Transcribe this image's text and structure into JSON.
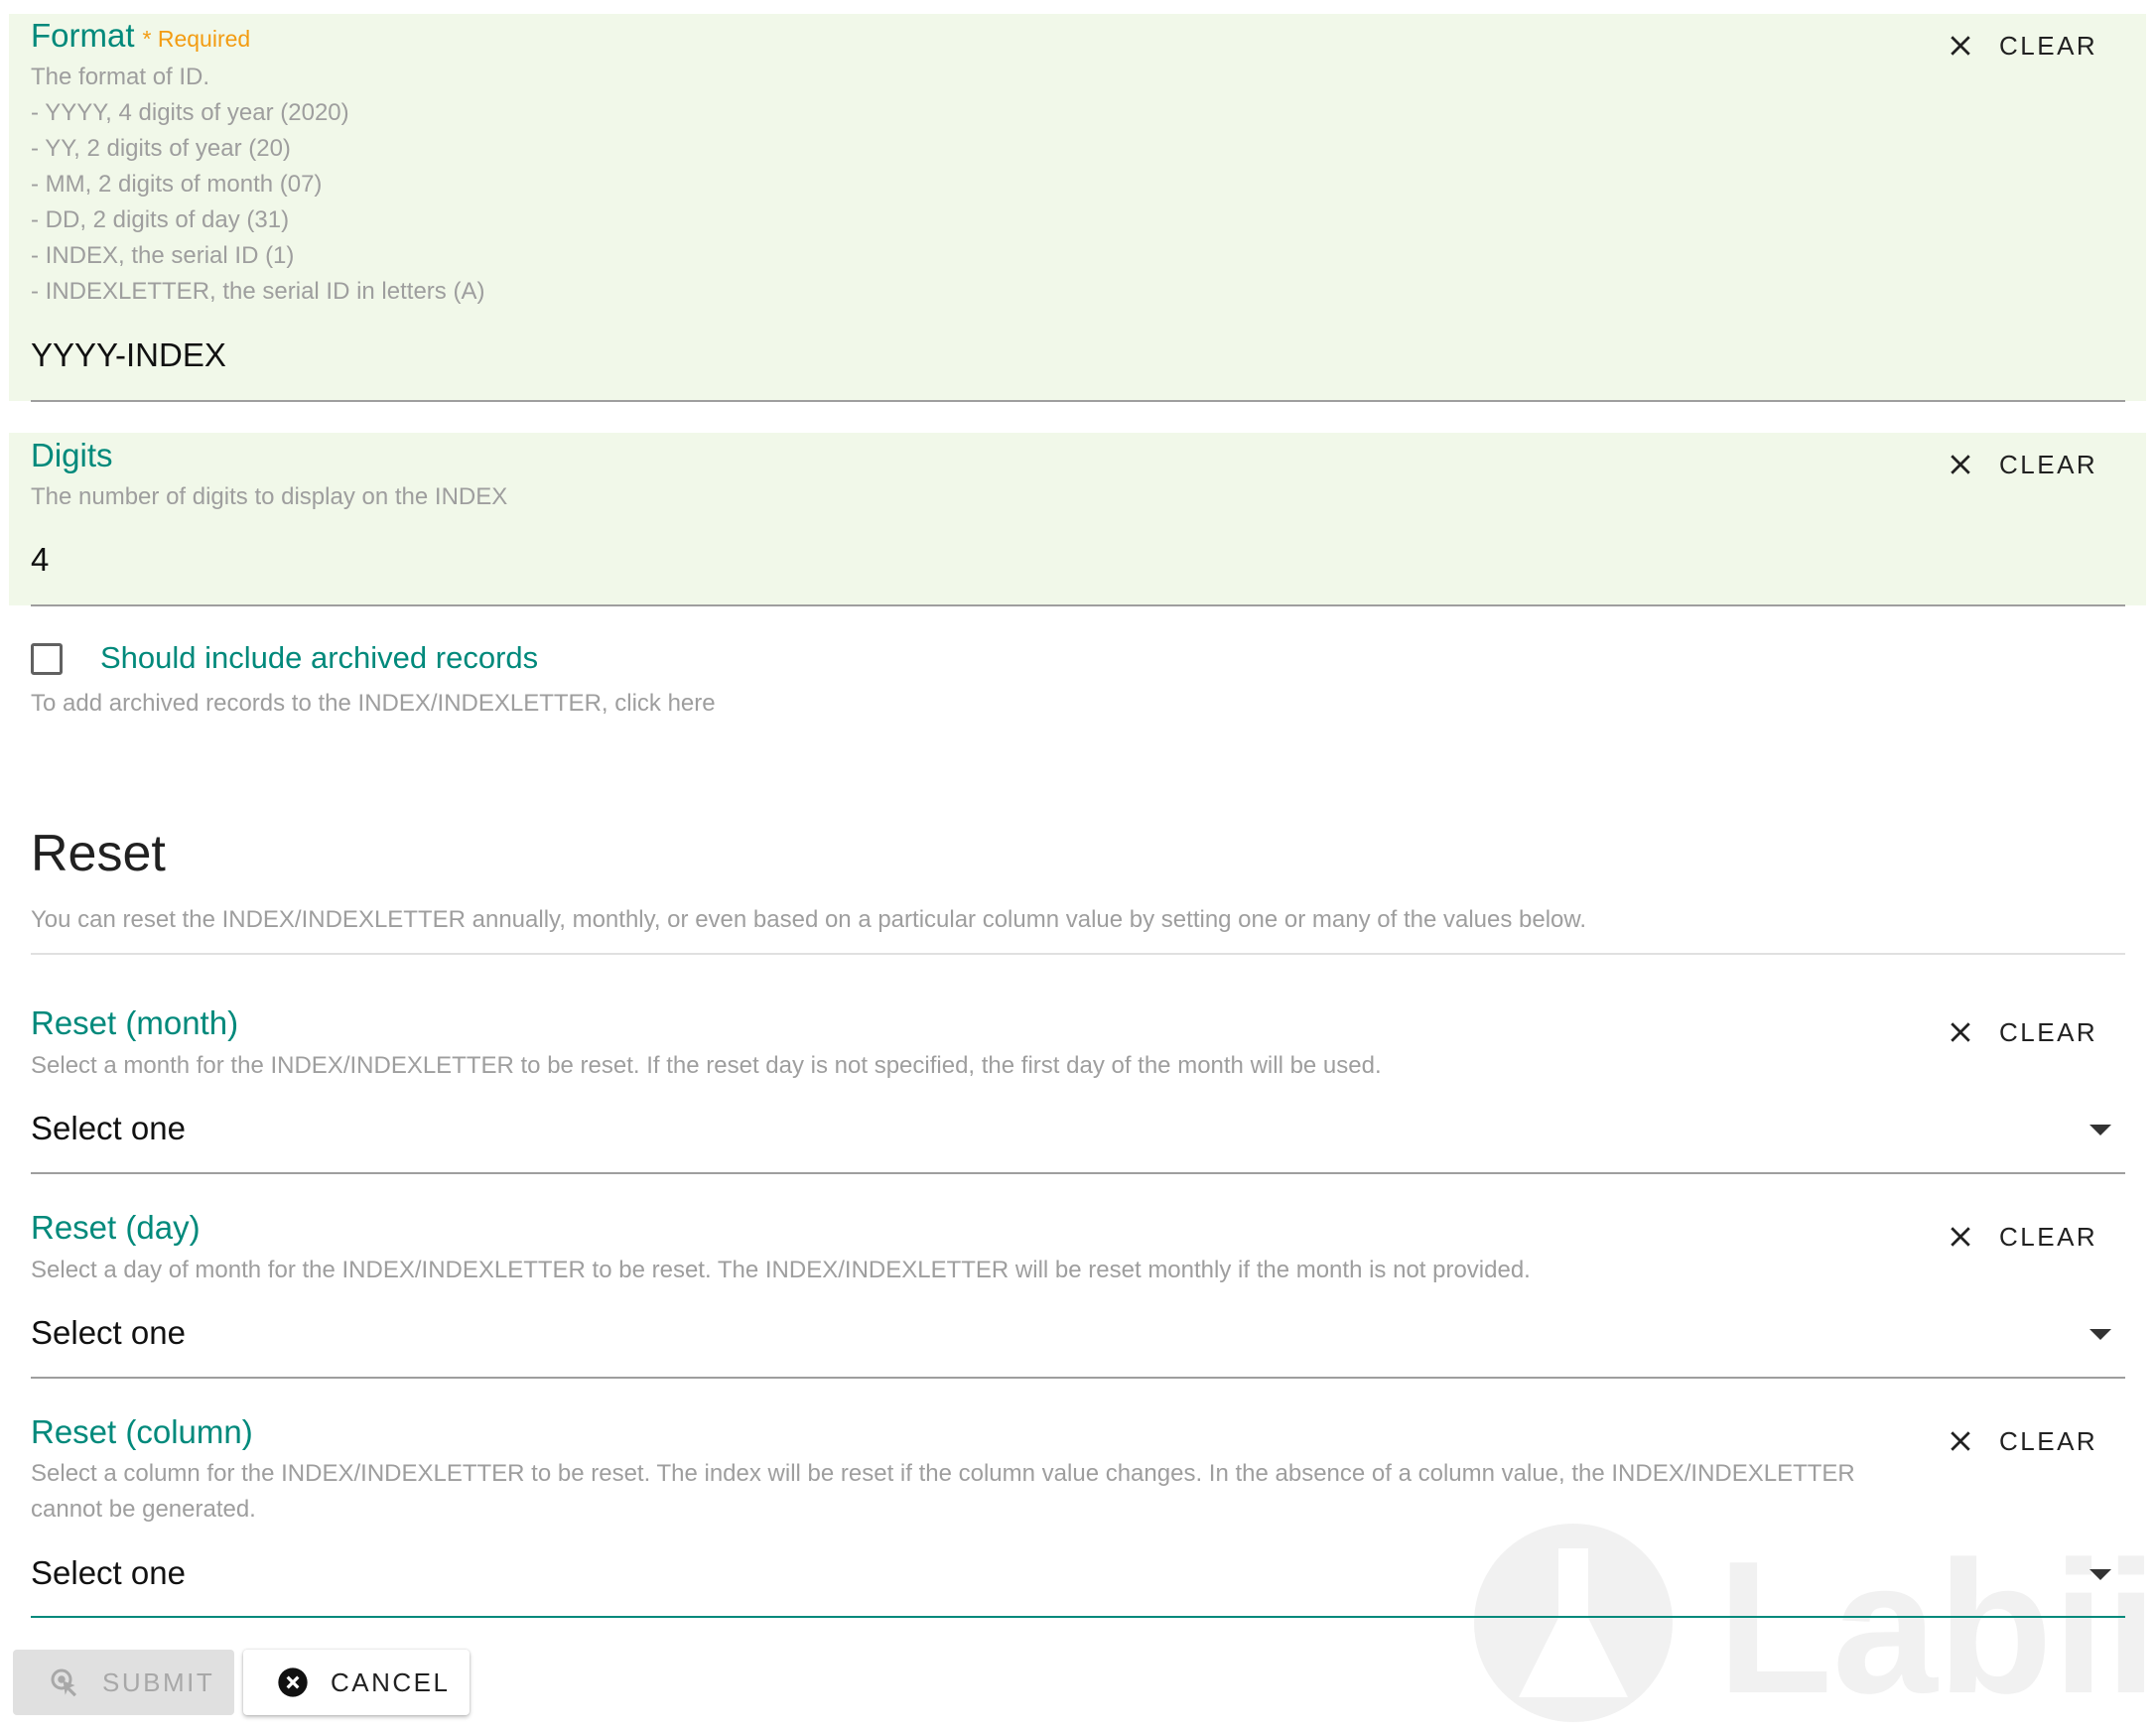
{
  "format": {
    "label": "Format",
    "required": "* Required",
    "help_lines": [
      "The format of ID.",
      "- YYYY, 4 digits of year (2020)",
      "- YY, 2 digits of year (20)",
      "- MM, 2 digits of month (07)",
      "- DD, 2 digits of day (31)",
      "- INDEX, the serial ID (1)",
      "- INDEXLETTER, the serial ID in letters (A)"
    ],
    "value": "YYYY-INDEX",
    "clear_label": "CLEAR"
  },
  "digits": {
    "label": "Digits",
    "help": "The number of digits to display on the INDEX",
    "value": "4",
    "clear_label": "CLEAR"
  },
  "archived": {
    "label": "Should include archived records",
    "help": "To add archived records to the INDEX/INDEXLETTER, click here",
    "checked": false
  },
  "reset": {
    "title": "Reset",
    "description": "You can reset the INDEX/INDEXLETTER annually, monthly, or even based on a particular column value by setting one or many of the values below.",
    "month": {
      "label": "Reset (month)",
      "help": "Select a month for the INDEX/INDEXLETTER to be reset. If the reset day is not specified, the first day of the month will be used.",
      "value": "Select one",
      "clear_label": "CLEAR"
    },
    "day": {
      "label": "Reset (day)",
      "help": "Select a day of month for the INDEX/INDEXLETTER to be reset. The INDEX/INDEXLETTER will be reset monthly if the month is not provided.",
      "value": "Select one",
      "clear_label": "CLEAR"
    },
    "column": {
      "label": "Reset (column)",
      "help_line1": "Select a column for the INDEX/INDEXLETTER to be reset. The index will be reset if the column value changes. In the absence of a column value, the INDEX/INDEXLETTER",
      "help_line2": "cannot be generated.",
      "value": "Select one",
      "clear_label": "CLEAR"
    }
  },
  "actions": {
    "submit_label": "SUBMIT",
    "cancel_label": "CANCEL"
  },
  "watermark": {
    "text": "Labii"
  },
  "colors": {
    "accent": "#00897b",
    "required": "#f39c12",
    "panel_bg": "#f1f8e9",
    "help_text": "#9e9e9e"
  }
}
